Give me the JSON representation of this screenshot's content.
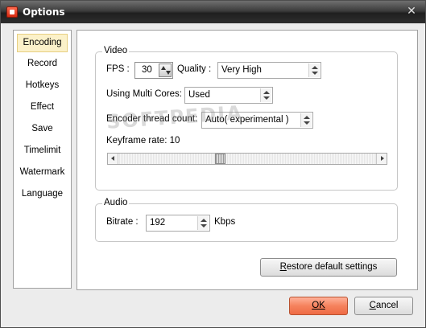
{
  "window": {
    "title": "Options",
    "close_glyph": "✕",
    "watermark": "SOFTPEDIA"
  },
  "sidebar": {
    "items": [
      {
        "label": "Encoding",
        "selected": true
      },
      {
        "label": "Record"
      },
      {
        "label": "Hotkeys"
      },
      {
        "label": "Effect"
      },
      {
        "label": "Save"
      },
      {
        "label": "Timelimit"
      },
      {
        "label": "Watermark"
      },
      {
        "label": "Language"
      }
    ]
  },
  "video": {
    "group_title": "Video",
    "fps_label": "FPS :",
    "fps_value": "30",
    "quality_label": "Quality :",
    "quality_value": "Very High",
    "multicore_label": "Using Multi Cores:",
    "multicore_value": "Used",
    "thread_label": "Encoder thread count:",
    "thread_value": "Auto( experimental )",
    "keyframe_label": "Keyframe rate: 10",
    "keyframe_position": 0.39
  },
  "audio": {
    "group_title": "Audio",
    "bitrate_label": "Bitrate :",
    "bitrate_value": "192",
    "bitrate_unit": "Kbps"
  },
  "buttons": {
    "restore_first": "R",
    "restore_rest": "estore default settings",
    "ok_label": "OK",
    "cancel_first": "C",
    "cancel_rest": "ancel"
  },
  "colors": {
    "selected_bg": "#fbf1c9",
    "ok_button": "#f5825d"
  }
}
